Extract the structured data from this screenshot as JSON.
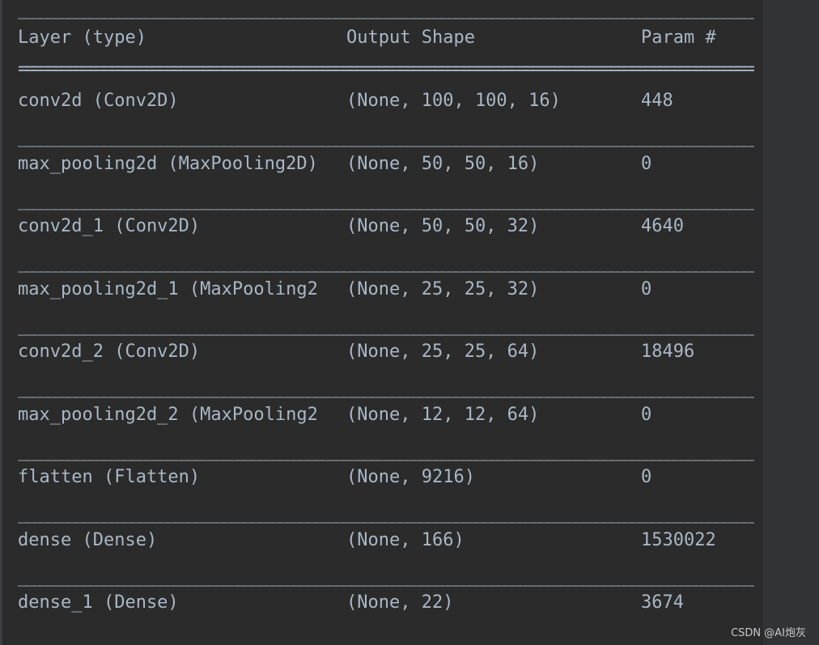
{
  "separator_dash": "________________________________________________________________________________________________________________________________________________________________________________________________",
  "separator_equals": "=======================================================================================================================================================================================================",
  "header": {
    "layer": "Layer (type)",
    "output_shape": "Output Shape",
    "params": "Param #"
  },
  "rows": [
    {
      "layer": "conv2d (Conv2D)",
      "output_shape": "(None, 100, 100, 16)",
      "params": "448"
    },
    {
      "layer": "max_pooling2d (MaxPooling2D)",
      "output_shape": "(None, 50, 50, 16)",
      "params": "0"
    },
    {
      "layer": "conv2d_1 (Conv2D)",
      "output_shape": "(None, 50, 50, 32)",
      "params": "4640"
    },
    {
      "layer": "max_pooling2d_1 (MaxPooling2",
      "output_shape": "(None, 25, 25, 32)",
      "params": "0"
    },
    {
      "layer": "conv2d_2 (Conv2D)",
      "output_shape": "(None, 25, 25, 64)",
      "params": "18496"
    },
    {
      "layer": "max_pooling2d_2 (MaxPooling2",
      "output_shape": "(None, 12, 12, 64)",
      "params": "0"
    },
    {
      "layer": "flatten (Flatten)",
      "output_shape": "(None, 9216)",
      "params": "0"
    },
    {
      "layer": "dense (Dense)",
      "output_shape": "(None, 166)",
      "params": "1530022"
    },
    {
      "layer": "dense_1 (Dense)",
      "output_shape": "(None, 22)",
      "params": "3674"
    }
  ],
  "watermark": "CSDN @AI炮灰"
}
